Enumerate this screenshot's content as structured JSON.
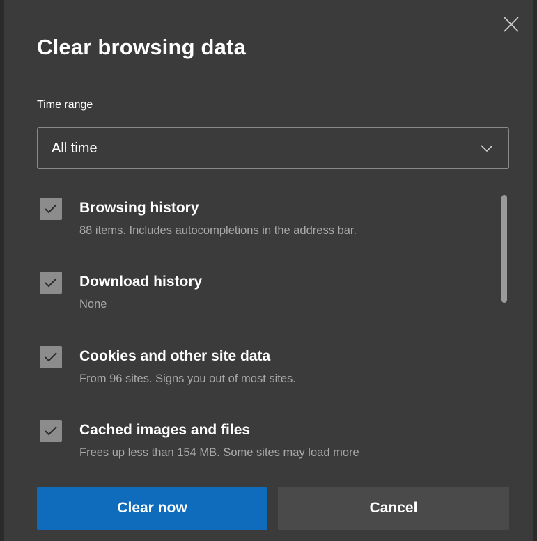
{
  "dialog": {
    "title": "Clear browsing data",
    "close_icon": "close-icon"
  },
  "time_range": {
    "label": "Time range",
    "selected": "All time",
    "chevron_icon": "chevron-down-icon"
  },
  "items": [
    {
      "title": "Browsing history",
      "description": "88 items. Includes autocompletions in the address bar.",
      "checked": true
    },
    {
      "title": "Download history",
      "description": "None",
      "checked": true
    },
    {
      "title": "Cookies and other site data",
      "description": "From 96 sites. Signs you out of most sites.",
      "checked": true
    },
    {
      "title": "Cached images and files",
      "description": "Frees up less than 154 MB. Some sites may load more",
      "checked": true
    }
  ],
  "buttons": {
    "primary": "Clear now",
    "secondary": "Cancel"
  },
  "colors": {
    "background": "#3b3b3b",
    "primary_button": "#0f6cbd",
    "secondary_button": "#4a4a4a",
    "checkbox": "#8c8c8c",
    "description_text": "#a9a9a9"
  }
}
